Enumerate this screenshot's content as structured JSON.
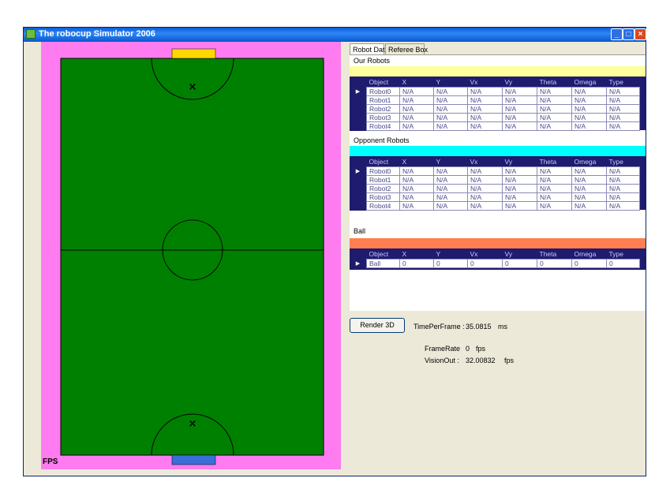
{
  "window": {
    "title": "The robocup Simulator 2006"
  },
  "tabs": [
    "Robot Data",
    "Referee Box"
  ],
  "columns": [
    "Object",
    "X",
    "Y",
    "Vx",
    "Vy",
    "Theta",
    "Omega",
    "Type"
  ],
  "our_robots": {
    "label": "Our Robots",
    "band_color": "#ffff9b",
    "rows": [
      [
        "Robot0",
        "N/A",
        "N/A",
        "N/A",
        "N/A",
        "N/A",
        "N/A",
        "N/A"
      ],
      [
        "Robot1",
        "N/A",
        "N/A",
        "N/A",
        "N/A",
        "N/A",
        "N/A",
        "N/A"
      ],
      [
        "Robot2",
        "N/A",
        "N/A",
        "N/A",
        "N/A",
        "N/A",
        "N/A",
        "N/A"
      ],
      [
        "Robot3",
        "N/A",
        "N/A",
        "N/A",
        "N/A",
        "N/A",
        "N/A",
        "N/A"
      ],
      [
        "Robot4",
        "N/A",
        "N/A",
        "N/A",
        "N/A",
        "N/A",
        "N/A",
        "N/A"
      ]
    ]
  },
  "opponent_robots": {
    "label": "Opponent Robots",
    "band_color": "#00ffff",
    "rows": [
      [
        "Robot0",
        "N/A",
        "N/A",
        "N/A",
        "N/A",
        "N/A",
        "N/A",
        "N/A"
      ],
      [
        "Robot1",
        "N/A",
        "N/A",
        "N/A",
        "N/A",
        "N/A",
        "N/A",
        "N/A"
      ],
      [
        "Robot2",
        "N/A",
        "N/A",
        "N/A",
        "N/A",
        "N/A",
        "N/A",
        "N/A"
      ],
      [
        "Robot3",
        "N/A",
        "N/A",
        "N/A",
        "N/A",
        "N/A",
        "N/A",
        "N/A"
      ],
      [
        "Robot4",
        "N/A",
        "N/A",
        "N/A",
        "N/A",
        "N/A",
        "N/A",
        "N/A"
      ]
    ]
  },
  "ball": {
    "label": "Ball",
    "band_color": "#ff7f50",
    "rows": [
      [
        "Ball",
        "0",
        "0",
        "0",
        "0",
        "0",
        "0",
        "0"
      ]
    ]
  },
  "controls": {
    "render_button": "Render 3D",
    "time_per_frame_label": "TimePerFrame :",
    "time_per_frame_value": "35.0815",
    "time_per_frame_unit": "ms",
    "frame_rate_label": "FrameRate",
    "frame_rate_value": "0",
    "frame_rate_unit": "fps",
    "vision_out_label": "VisionOut :",
    "vision_out_value": "32.00832",
    "vision_out_unit": "fps"
  },
  "field": {
    "fps_label": "FPS",
    "border_color": "#ff7bf0",
    "pitch_color": "#008000",
    "top_goal_color": "#ffd700",
    "bottom_goal_color": "#3a6fd8",
    "marker_glyph": "×"
  },
  "colors": {
    "title_bar": "#0a5ed8",
    "grid_header": "#1f1b6e"
  }
}
